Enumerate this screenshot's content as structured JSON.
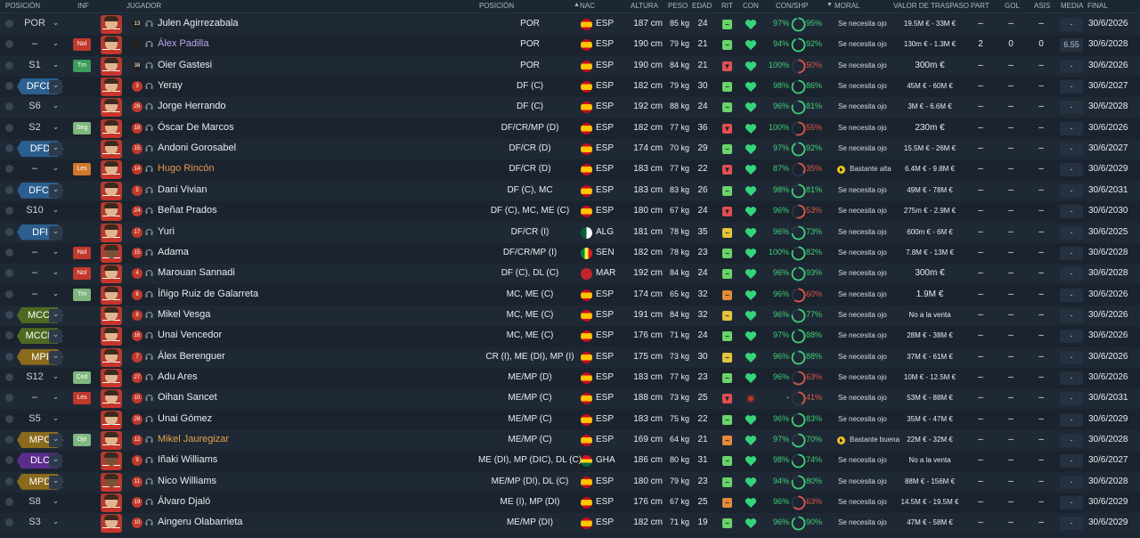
{
  "headers": {
    "posicion": "POSICIÓN",
    "inf": "INF",
    "jugador": "JUGADOR",
    "posicion2": "POSICIÓN",
    "sort_arrow": "▲",
    "nac": "NAC",
    "altura": "ALTURA",
    "peso": "PESO",
    "edad": "EDAD",
    "rit": "RIT",
    "con": "CON",
    "conshp": "CON/SHP",
    "moral_arrow": "▼",
    "moral": "MORAL",
    "valor": "VALOR DE TRASPASO",
    "part": "PART",
    "gol": "GOL",
    "asis": "ASIS",
    "media": "MEDIA",
    "final": "FINAL"
  },
  "colors": {
    "tag_blue": "#2b5f8f",
    "tag_green": "#4e6a22",
    "tag_gold": "#8a6a1c",
    "tag_purple": "#5a2d8c",
    "inf_red": "#c0392b",
    "inf_green": "#3e9c5a",
    "inf_orange": "#d0782a",
    "inf_lightgreen": "#7fb77e",
    "pct_green": "#3fd17a",
    "pct_red": "#e0584a",
    "heart_green": "#35d47a",
    "rit_green": "#6ad36a",
    "rit_yellow": "#e3c43a",
    "rit_orange": "#e58a3a",
    "rit_red": "#e24f4f"
  },
  "players": [
    {
      "pos": "POR",
      "pos_style": "plain",
      "inf": "",
      "inf_color": "",
      "kit": "13",
      "gk": true,
      "name": "Julen Agirrezabala",
      "name_color": "#e8ecf0",
      "position": "POR",
      "flag": "esp",
      "nat": "ESP",
      "altura": "187 cm",
      "peso": "85 kg",
      "edad": "24",
      "rit": "green",
      "rit_mark": "−",
      "con": "green",
      "con_pct": "97%",
      "shp": "95%",
      "shp_color": "green",
      "moral": "Se necesita ojo",
      "moral_icon": false,
      "valor": "19.5M € - 33M €",
      "valor_big": false,
      "part": "–",
      "gol": "–",
      "asis": "–",
      "media": "-",
      "final": "30/6/2026"
    },
    {
      "pos": "–",
      "pos_style": "plain",
      "inf": "Nol",
      "inf_color": "inf_red",
      "kit": "",
      "gk": true,
      "name": "Álex Padilla",
      "name_color": "#b9a7e8",
      "position": "POR",
      "flag": "esp",
      "nat": "ESP",
      "altura": "190 cm",
      "peso": "79 kg",
      "edad": "21",
      "rit": "green",
      "rit_mark": "−",
      "con": "green",
      "con_pct": "94%",
      "shp": "92%",
      "shp_color": "green",
      "moral": "Se necesita ojo",
      "moral_icon": false,
      "valor": "130m € - 1.3M €",
      "valor_big": false,
      "part": "2",
      "gol": "0",
      "asis": "0",
      "media": "6.55",
      "final": "30/6/2028"
    },
    {
      "pos": "S1",
      "pos_style": "plain",
      "inf": "Tm",
      "inf_color": "inf_green",
      "kit": "38",
      "gk": true,
      "name": "Oier Gastesi",
      "name_color": "#e8ecf0",
      "position": "POR",
      "flag": "esp",
      "nat": "ESP",
      "altura": "190 cm",
      "peso": "84 kg",
      "edad": "21",
      "rit": "red",
      "rit_mark": "▼",
      "con": "green",
      "con_pct": "100%",
      "shp": "50%",
      "shp_color": "red",
      "moral": "Se necesita ojo",
      "moral_icon": false,
      "valor": "300m €",
      "valor_big": true,
      "part": "–",
      "gol": "–",
      "asis": "–",
      "media": "-",
      "final": "30/6/2026"
    },
    {
      "pos": "DFCD",
      "pos_style": "tag_blue",
      "inf": "",
      "inf_color": "",
      "kit": "3",
      "gk": false,
      "name": "Yeray",
      "name_color": "#e8ecf0",
      "position": "DF (C)",
      "flag": "esp",
      "nat": "ESP",
      "altura": "182 cm",
      "peso": "79 kg",
      "edad": "30",
      "rit": "green",
      "rit_mark": "−",
      "con": "green",
      "con_pct": "98%",
      "shp": "86%",
      "shp_color": "green",
      "moral": "Se necesita ojo",
      "moral_icon": false,
      "valor": "45M € - 60M €",
      "valor_big": false,
      "part": "–",
      "gol": "–",
      "asis": "–",
      "media": "-",
      "final": "30/6/2027"
    },
    {
      "pos": "S6",
      "pos_style": "plain",
      "inf": "",
      "inf_color": "",
      "kit": "26",
      "gk": false,
      "name": "Jorge Herrando",
      "name_color": "#e8ecf0",
      "position": "DF (C)",
      "flag": "esp",
      "nat": "ESP",
      "altura": "192 cm",
      "peso": "88 kg",
      "edad": "24",
      "rit": "green",
      "rit_mark": "−",
      "con": "green",
      "con_pct": "96%",
      "shp": "81%",
      "shp_color": "green",
      "moral": "Se necesita ojo",
      "moral_icon": false,
      "valor": "3M € - 6.6M €",
      "valor_big": false,
      "part": "–",
      "gol": "–",
      "asis": "–",
      "media": "-",
      "final": "30/6/2028"
    },
    {
      "pos": "S2",
      "pos_style": "plain",
      "inf": "Seg",
      "inf_color": "inf_lightgreen",
      "kit": "18",
      "gk": false,
      "name": "Óscar De Marcos",
      "name_color": "#e8ecf0",
      "position": "DF/CR/MP (D)",
      "flag": "esp",
      "nat": "ESP",
      "altura": "182 cm",
      "peso": "77 kg",
      "edad": "36",
      "rit": "red",
      "rit_mark": "▼",
      "con": "green",
      "con_pct": "100%",
      "shp": "55%",
      "shp_color": "red",
      "moral": "Se necesita ojo",
      "moral_icon": false,
      "valor": "230m €",
      "valor_big": true,
      "part": "–",
      "gol": "–",
      "asis": "–",
      "media": "-",
      "final": "30/6/2026"
    },
    {
      "pos": "DFD",
      "pos_style": "tag_blue",
      "inf": "",
      "inf_color": "",
      "kit": "15",
      "gk": false,
      "name": "Andoni Gorosabel",
      "name_color": "#e8ecf0",
      "position": "DF/CR (D)",
      "flag": "esp",
      "nat": "ESP",
      "altura": "174 cm",
      "peso": "70 kg",
      "edad": "29",
      "rit": "green",
      "rit_mark": "−",
      "con": "green",
      "con_pct": "97%",
      "shp": "92%",
      "shp_color": "green",
      "moral": "Se necesita ojo",
      "moral_icon": false,
      "valor": "15.5M € - 26M €",
      "valor_big": false,
      "part": "–",
      "gol": "–",
      "asis": "–",
      "media": "-",
      "final": "30/6/2027"
    },
    {
      "pos": "–",
      "pos_style": "plain",
      "inf": "Les",
      "inf_color": "inf_orange",
      "kit": "14",
      "gk": false,
      "name": "Hugo Rincón",
      "name_color": "#e89a4a",
      "position": "DF/CR (D)",
      "flag": "esp",
      "nat": "ESP",
      "altura": "183 cm",
      "peso": "77 kg",
      "edad": "22",
      "rit": "red",
      "rit_mark": "▼",
      "con": "green",
      "con_pct": "87%",
      "shp": "35%",
      "shp_color": "red",
      "moral": "Bastante alta",
      "moral_icon": true,
      "valor": "6.4M € - 9.8M €",
      "valor_big": false,
      "part": "–",
      "gol": "–",
      "asis": "–",
      "media": "-",
      "final": "30/6/2029"
    },
    {
      "pos": "DFCI",
      "pos_style": "tag_blue",
      "inf": "",
      "inf_color": "",
      "kit": "5",
      "gk": false,
      "name": "Dani Vivian",
      "name_color": "#e8ecf0",
      "position": "DF (C), MC",
      "flag": "esp",
      "nat": "ESP",
      "altura": "183 cm",
      "peso": "83 kg",
      "edad": "26",
      "rit": "green",
      "rit_mark": "−",
      "con": "green",
      "con_pct": "98%",
      "shp": "81%",
      "shp_color": "green",
      "moral": "Se necesita ojo",
      "moral_icon": false,
      "valor": "49M € - 78M €",
      "valor_big": false,
      "part": "–",
      "gol": "–",
      "asis": "–",
      "media": "-",
      "final": "30/6/2031"
    },
    {
      "pos": "S10",
      "pos_style": "plain",
      "inf": "",
      "inf_color": "",
      "kit": "24",
      "gk": false,
      "name": "Beñat Prados",
      "name_color": "#e8ecf0",
      "position": "DF (C), MC, ME (C)",
      "flag": "esp",
      "nat": "ESP",
      "altura": "180 cm",
      "peso": "67 kg",
      "edad": "24",
      "rit": "red",
      "rit_mark": "▼",
      "con": "green",
      "con_pct": "96%",
      "shp": "53%",
      "shp_color": "red",
      "moral": "Se necesita ojo",
      "moral_icon": false,
      "valor": "275m € - 2.9M €",
      "valor_big": false,
      "part": "–",
      "gol": "–",
      "asis": "–",
      "media": "-",
      "final": "30/6/2030"
    },
    {
      "pos": "DFI",
      "pos_style": "tag_blue",
      "inf": "",
      "inf_color": "",
      "kit": "17",
      "gk": false,
      "name": "Yuri",
      "name_color": "#e8ecf0",
      "position": "DF/CR (I)",
      "flag": "alg",
      "nat": "ALG",
      "altura": "181 cm",
      "peso": "78 kg",
      "edad": "35",
      "rit": "yellow",
      "rit_mark": "−",
      "con": "green",
      "con_pct": "96%",
      "shp": "73%",
      "shp_color": "green",
      "moral": "Se necesita ojo",
      "moral_icon": false,
      "valor": "600m € - 6M €",
      "valor_big": false,
      "part": "–",
      "gol": "–",
      "asis": "–",
      "media": "-",
      "final": "30/6/2025"
    },
    {
      "pos": "–",
      "pos_style": "plain",
      "inf": "Nol",
      "inf_color": "inf_red",
      "kit": "15",
      "gk": false,
      "dark": true,
      "name": "Adama",
      "name_color": "#e8ecf0",
      "position": "DF/CR/MP (I)",
      "flag": "sen",
      "nat": "SEN",
      "altura": "182 cm",
      "peso": "78 kg",
      "edad": "23",
      "rit": "green",
      "rit_mark": "−",
      "con": "green",
      "con_pct": "100%",
      "shp": "82%",
      "shp_color": "green",
      "moral": "Se necesita ojo",
      "moral_icon": false,
      "valor": "7.8M € - 13M €",
      "valor_big": false,
      "part": "–",
      "gol": "–",
      "asis": "–",
      "media": "-",
      "final": "30/6/2028"
    },
    {
      "pos": "–",
      "pos_style": "plain",
      "inf": "Nol",
      "inf_color": "inf_red",
      "kit": "4",
      "gk": false,
      "name": "Marouan Sannadi",
      "name_color": "#e8ecf0",
      "position": "DF (C), DL (C)",
      "flag": "mar",
      "nat": "MAR",
      "altura": "192 cm",
      "peso": "84 kg",
      "edad": "24",
      "rit": "green",
      "rit_mark": "−",
      "con": "green",
      "con_pct": "96%",
      "shp": "93%",
      "shp_color": "green",
      "moral": "Se necesita ojo",
      "moral_icon": false,
      "valor": "300m €",
      "valor_big": true,
      "part": "–",
      "gol": "–",
      "asis": "–",
      "media": "-",
      "final": "30/6/2028"
    },
    {
      "pos": "–",
      "pos_style": "plain",
      "inf": "Tm",
      "inf_color": "inf_lightgreen",
      "kit": "6",
      "gk": false,
      "name": "Íñigo Ruiz de Galarreta",
      "name_color": "#e8ecf0",
      "position": "MC, ME (C)",
      "flag": "esp",
      "nat": "ESP",
      "altura": "174 cm",
      "peso": "65 kg",
      "edad": "32",
      "rit": "orange",
      "rit_mark": "−",
      "con": "green",
      "con_pct": "96%",
      "shp": "60%",
      "shp_color": "red",
      "moral": "Se necesita ojo",
      "moral_icon": false,
      "valor": "1.9M €",
      "valor_big": true,
      "part": "–",
      "gol": "–",
      "asis": "–",
      "media": "-",
      "final": "30/6/2026"
    },
    {
      "pos": "MCCI",
      "pos_style": "tag_green",
      "inf": "",
      "inf_color": "",
      "kit": "8",
      "gk": false,
      "name": "Mikel Vesga",
      "name_color": "#e8ecf0",
      "position": "MC, ME (C)",
      "flag": "esp",
      "nat": "ESP",
      "altura": "191 cm",
      "peso": "84 kg",
      "edad": "32",
      "rit": "yellow",
      "rit_mark": "−",
      "con": "green",
      "con_pct": "96%",
      "shp": "77%",
      "shp_color": "green",
      "moral": "Se necesita ojo",
      "moral_icon": false,
      "valor": "No a la venta",
      "valor_big": false,
      "part": "–",
      "gol": "–",
      "asis": "–",
      "media": "-",
      "final": "30/6/2026"
    },
    {
      "pos": "MCCD",
      "pos_style": "tag_green",
      "inf": "",
      "inf_color": "",
      "kit": "16",
      "gk": false,
      "name": "Unai Vencedor",
      "name_color": "#e8ecf0",
      "position": "MC, ME (C)",
      "flag": "esp",
      "nat": "ESP",
      "altura": "176 cm",
      "peso": "71 kg",
      "edad": "24",
      "rit": "green",
      "rit_mark": "−",
      "con": "green",
      "con_pct": "97%",
      "shp": "88%",
      "shp_color": "green",
      "moral": "Se necesita ojo",
      "moral_icon": false,
      "valor": "28M € - 38M €",
      "valor_big": false,
      "part": "–",
      "gol": "–",
      "asis": "–",
      "media": "-",
      "final": "30/6/2026"
    },
    {
      "pos": "MPI",
      "pos_style": "tag_gold",
      "inf": "",
      "inf_color": "",
      "kit": "7",
      "gk": false,
      "name": "Álex Berenguer",
      "name_color": "#e8ecf0",
      "position": "CR (I), ME (DI), MP (I)",
      "flag": "esp",
      "nat": "ESP",
      "altura": "175 cm",
      "peso": "73 kg",
      "edad": "30",
      "rit": "yellow",
      "rit_mark": "−",
      "con": "green",
      "con_pct": "96%",
      "shp": "88%",
      "shp_color": "green",
      "moral": "Se necesita ojo",
      "moral_icon": false,
      "valor": "37M € - 61M €",
      "valor_big": false,
      "part": "–",
      "gol": "–",
      "asis": "–",
      "media": "-",
      "final": "30/6/2026"
    },
    {
      "pos": "S12",
      "pos_style": "plain",
      "inf": "Ced",
      "inf_color": "inf_lightgreen",
      "kit": "27",
      "gk": false,
      "name": "Adu Ares",
      "name_color": "#e8ecf0",
      "position": "ME/MP (D)",
      "flag": "esp",
      "nat": "ESP",
      "altura": "183 cm",
      "peso": "77 kg",
      "edad": "23",
      "rit": "green",
      "rit_mark": "−",
      "con": "green",
      "con_pct": "96%",
      "shp": "63%",
      "shp_color": "red",
      "moral": "Se necesita ojo",
      "moral_icon": false,
      "valor": "10M € - 12.5M €",
      "valor_big": false,
      "part": "–",
      "gol": "–",
      "asis": "–",
      "media": "-",
      "final": "30/6/2026"
    },
    {
      "pos": "–",
      "pos_style": "plain",
      "inf": "Les",
      "inf_color": "inf_red",
      "kit": "10",
      "gk": false,
      "name": "Oihan Sancet",
      "name_color": "#e8ecf0",
      "position": "ME/MP (C)",
      "flag": "esp",
      "nat": "ESP",
      "altura": "188 cm",
      "peso": "73 kg",
      "edad": "25",
      "rit": "red",
      "rit_mark": "▼",
      "con": "red",
      "con_pct": "-",
      "shp": "41%",
      "shp_color": "red",
      "moral": "Se necesita ojo",
      "moral_icon": false,
      "valor": "53M € - 88M €",
      "valor_big": false,
      "part": "–",
      "gol": "–",
      "asis": "–",
      "media": "-",
      "final": "30/6/2031"
    },
    {
      "pos": "S5",
      "pos_style": "plain",
      "inf": "",
      "inf_color": "",
      "kit": "28",
      "gk": false,
      "name": "Unai Gómez",
      "name_color": "#e8ecf0",
      "position": "ME/MP (C)",
      "flag": "esp",
      "nat": "ESP",
      "altura": "183 cm",
      "peso": "75 kg",
      "edad": "22",
      "rit": "green",
      "rit_mark": "−",
      "con": "green",
      "con_pct": "96%",
      "shp": "83%",
      "shp_color": "green",
      "moral": "Se necesita ojo",
      "moral_icon": false,
      "valor": "35M € - 47M €",
      "valor_big": false,
      "part": "–",
      "gol": "–",
      "asis": "–",
      "media": "-",
      "final": "30/6/2029"
    },
    {
      "pos": "MPC",
      "pos_style": "tag_gold",
      "inf": "Oje",
      "inf_color": "inf_lightgreen",
      "kit": "12",
      "gk": false,
      "name": "Mikel Jauregizar",
      "name_color": "#e8a04a",
      "position": "ME/MP (C)",
      "flag": "esp",
      "nat": "ESP",
      "altura": "169 cm",
      "peso": "64 kg",
      "edad": "21",
      "rit": "orange",
      "rit_mark": "−",
      "con": "green",
      "con_pct": "97%",
      "shp": "70%",
      "shp_color": "green",
      "moral": "Bastante buena",
      "moral_icon": true,
      "valor": "22M € - 32M €",
      "valor_big": false,
      "part": "–",
      "gol": "–",
      "asis": "–",
      "media": "-",
      "final": "30/6/2028"
    },
    {
      "pos": "DLC",
      "pos_style": "tag_purple",
      "inf": "",
      "inf_color": "",
      "kit": "9",
      "gk": false,
      "dark": true,
      "name": "Iñaki Williams",
      "name_color": "#e8ecf0",
      "position": "ME (DI), MP (DIC), DL (C)",
      "flag": "gha",
      "nat": "GHA",
      "altura": "186 cm",
      "peso": "80 kg",
      "edad": "31",
      "rit": "green",
      "rit_mark": "−",
      "con": "green",
      "con_pct": "98%",
      "shp": "74%",
      "shp_color": "green",
      "moral": "Se necesita ojo",
      "moral_icon": false,
      "valor": "No a la venta",
      "valor_big": false,
      "part": "–",
      "gol": "–",
      "asis": "–",
      "media": "-",
      "final": "30/6/2027"
    },
    {
      "pos": "MPD",
      "pos_style": "tag_gold",
      "inf": "",
      "inf_color": "",
      "kit": "11",
      "gk": false,
      "dark": true,
      "name": "Nico Williams",
      "name_color": "#e8ecf0",
      "position": "ME/MP (DI), DL (C)",
      "flag": "esp",
      "nat": "ESP",
      "altura": "180 cm",
      "peso": "79 kg",
      "edad": "23",
      "rit": "green",
      "rit_mark": "−",
      "con": "green",
      "con_pct": "94%",
      "shp": "80%",
      "shp_color": "green",
      "moral": "Se necesita ojo",
      "moral_icon": false,
      "valor": "88M € - 156M €",
      "valor_big": false,
      "part": "–",
      "gol": "–",
      "asis": "–",
      "media": "-",
      "final": "30/6/2028"
    },
    {
      "pos": "S8",
      "pos_style": "plain",
      "inf": "",
      "inf_color": "",
      "kit": "19",
      "gk": false,
      "name": "Álvaro Djaló",
      "name_color": "#e8ecf0",
      "position": "ME (I), MP (DI)",
      "flag": "esp",
      "nat": "ESP",
      "altura": "176 cm",
      "peso": "67 kg",
      "edad": "25",
      "rit": "orange",
      "rit_mark": "−",
      "con": "green",
      "con_pct": "96%",
      "shp": "63%",
      "shp_color": "red",
      "moral": "Se necesita ojo",
      "moral_icon": false,
      "valor": "14.5M € - 19.5M €",
      "valor_big": false,
      "part": "–",
      "gol": "–",
      "asis": "–",
      "media": "-",
      "final": "30/6/2029"
    },
    {
      "pos": "S3",
      "pos_style": "plain",
      "inf": "",
      "inf_color": "",
      "kit": "10",
      "gk": false,
      "name": "Aingeru Olabarrieta",
      "name_color": "#e8ecf0",
      "position": "ME/MP (DI)",
      "flag": "esp",
      "nat": "ESP",
      "altura": "182 cm",
      "peso": "71 kg",
      "edad": "19",
      "rit": "green",
      "rit_mark": "−",
      "con": "green",
      "con_pct": "96%",
      "shp": "90%",
      "shp_color": "green",
      "moral": "Se necesita ojo",
      "moral_icon": false,
      "valor": "47M € - 58M €",
      "valor_big": false,
      "part": "–",
      "gol": "–",
      "asis": "–",
      "media": "-",
      "final": "30/6/2029"
    }
  ]
}
